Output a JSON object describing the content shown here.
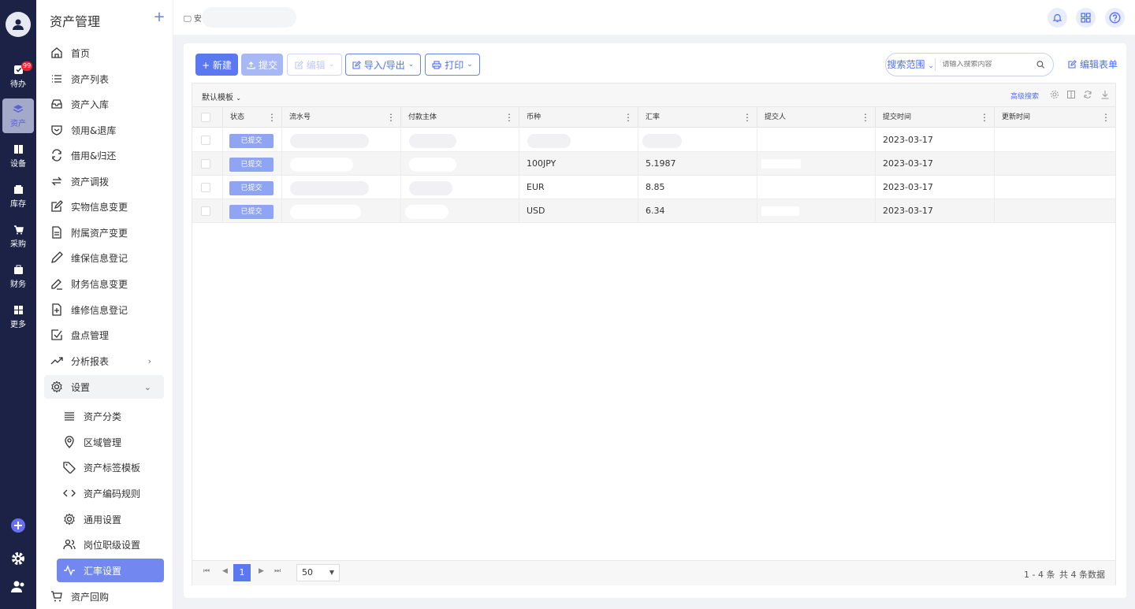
{
  "rail": {
    "items": [
      {
        "label": "待办",
        "icon": "todo-icon",
        "badge": "99"
      },
      {
        "label": "资产",
        "icon": "layers-icon"
      },
      {
        "label": "设备",
        "icon": "device-icon"
      },
      {
        "label": "库存",
        "icon": "inventory-icon"
      },
      {
        "label": "采购",
        "icon": "cart-icon"
      },
      {
        "label": "财务",
        "icon": "finance-icon"
      },
      {
        "label": "更多",
        "icon": "grid-icon"
      }
    ],
    "active": "资产"
  },
  "menu": {
    "title": "资产管理",
    "plus": "+",
    "items": [
      {
        "label": "首页",
        "icon": "home-icon"
      },
      {
        "label": "资产列表",
        "icon": "list-icon"
      },
      {
        "label": "资产入库",
        "icon": "inbox-icon"
      },
      {
        "label": "领用&退库",
        "icon": "shield-icon"
      },
      {
        "label": "借用&归还",
        "icon": "sync-icon"
      },
      {
        "label": "资产调拨",
        "icon": "swap-icon"
      },
      {
        "label": "实物信息变更",
        "icon": "edit-icon"
      },
      {
        "label": "附属资产变更",
        "icon": "file-icon"
      },
      {
        "label": "维保信息登记",
        "icon": "pen-icon"
      },
      {
        "label": "财务信息变更",
        "icon": "pen-line-icon"
      },
      {
        "label": "维修信息登记",
        "icon": "file-plus-icon"
      },
      {
        "label": "盘点管理",
        "icon": "check-square-icon"
      },
      {
        "label": "分析报表",
        "icon": "trend-icon"
      },
      {
        "label": "设置",
        "icon": "gear-icon"
      }
    ],
    "settings_sub": [
      {
        "label": "资产分类",
        "icon": "menu-icon"
      },
      {
        "label": "区域管理",
        "icon": "location-icon"
      },
      {
        "label": "资产标签模板",
        "icon": "tag-icon"
      },
      {
        "label": "资产编码规则",
        "icon": "code-icon"
      },
      {
        "label": "通用设置",
        "icon": "gear-icon"
      },
      {
        "label": "岗位职级设置",
        "icon": "users-icon"
      },
      {
        "label": "汇率设置",
        "icon": "pulse-icon"
      }
    ],
    "after": [
      {
        "label": "资产回购",
        "icon": "cart-icon"
      }
    ],
    "selected": "汇率设置"
  },
  "topbar": {
    "crumb": "安"
  },
  "toolbar": {
    "new": "+ 新建",
    "submit": "提交",
    "edit": "编辑",
    "import_export": "导入/导出",
    "print": "打印",
    "search_scope": "搜索范围",
    "search_placeholder": "请输入搜索内容",
    "edit_form": "编辑表单"
  },
  "grid": {
    "template": "默认模板",
    "advanced_search": "高级搜索",
    "columns": [
      "状态",
      "流水号",
      "付款主体",
      "币种",
      "汇率",
      "提交人",
      "提交时间",
      "更新时间"
    ],
    "rows": [
      {
        "status": "已提交",
        "currency": "",
        "rate": "",
        "submit_time": "2023-03-17",
        "update_time": ""
      },
      {
        "status": "已提交",
        "currency": "100JPY",
        "rate": "5.1987",
        "submit_time": "2023-03-17",
        "update_time": ""
      },
      {
        "status": "已提交",
        "currency": "EUR",
        "rate": "8.85",
        "submit_time": "2023-03-17",
        "update_time": ""
      },
      {
        "status": "已提交",
        "currency": "USD",
        "rate": "6.34",
        "submit_time": "2023-03-17",
        "update_time": ""
      }
    ],
    "pagination": {
      "current": "1",
      "page_size": "50",
      "range": "1 - 4 条",
      "total": "共 4 条数据"
    }
  },
  "colors": {
    "primary": "#5b78f0",
    "rail_bg": "#1b2245",
    "tag": "#8fa4f3"
  }
}
